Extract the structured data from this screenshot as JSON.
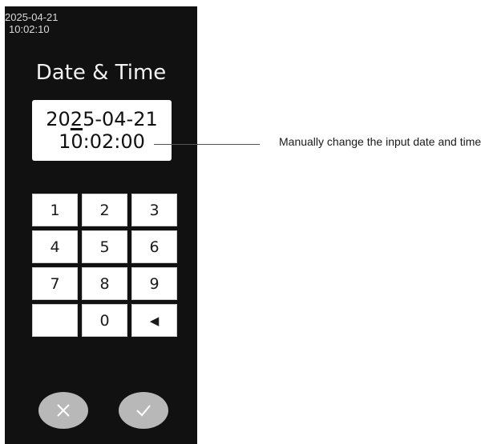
{
  "status": {
    "date": "2025-04-21",
    "time": "10:02:10"
  },
  "screen": {
    "title": "Date & Time"
  },
  "input": {
    "date_prefix": "20",
    "date_cursor_char": "2",
    "date_suffix": "5-04-21",
    "time": "10:02:00"
  },
  "keypad": {
    "keys": [
      "1",
      "2",
      "3",
      "4",
      "5",
      "6",
      "7",
      "8",
      "9",
      "",
      "0",
      "◀"
    ]
  },
  "buttons": {
    "cancel_icon": "close-icon",
    "confirm_icon": "check-icon"
  },
  "annotation": {
    "text": "Manually change the input date and time"
  },
  "colors": {
    "screen_bg": "#111111",
    "text_light": "#f2f2f2",
    "button_gray": "#b8b8b8",
    "key_bg": "#ffffff"
  }
}
